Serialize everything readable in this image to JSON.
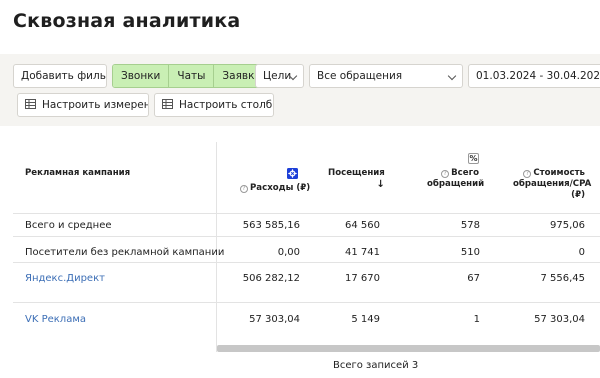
{
  "page": {
    "title": "Сквозная аналитика"
  },
  "filters": {
    "add_filter": "Добавить фильтр",
    "channels": [
      "Звонки",
      "Чаты",
      "Заявки"
    ],
    "goals": "Цели",
    "requests_select": "Все обращения",
    "date_range": "01.03.2024 - 30.04.2024",
    "configure_dimensions": "Настроить измерения",
    "configure_columns": "Настроить столбцы"
  },
  "table": {
    "columns": {
      "campaign": "Рекламная кампания",
      "spend": "Расходы (₽)",
      "visits": "Посещения",
      "requests_line1": "Всего",
      "requests_line2": "обращений",
      "cpa_line1": "Стоимость",
      "cpa_line2": "обращения/CPA",
      "cpa_line3": "(₽)",
      "percent_toggle": "%",
      "help": "?"
    },
    "rows": [
      {
        "name": "Всего и среднее",
        "spend": "563 585,16",
        "visits": "64 560",
        "requests": "578",
        "cpa": "975,06"
      },
      {
        "name": "Посетители без рекламной кампании",
        "spend": "0,00",
        "visits": "41 741",
        "requests": "510",
        "cpa": "0"
      },
      {
        "name": "Яндекс.Директ",
        "spend": "506 282,12",
        "visits": "17 670",
        "requests": "67",
        "cpa": "7 556,45"
      },
      {
        "name": "VK Реклама",
        "spend": "57 303,04",
        "visits": "5 149",
        "requests": "1",
        "cpa": "57 303,04"
      }
    ],
    "total_records": "Всего записей 3"
  },
  "colors": {
    "segment_bg": "#c9efb4",
    "link": "#3d6fb6",
    "settings_icon": "#1d3fd8"
  }
}
